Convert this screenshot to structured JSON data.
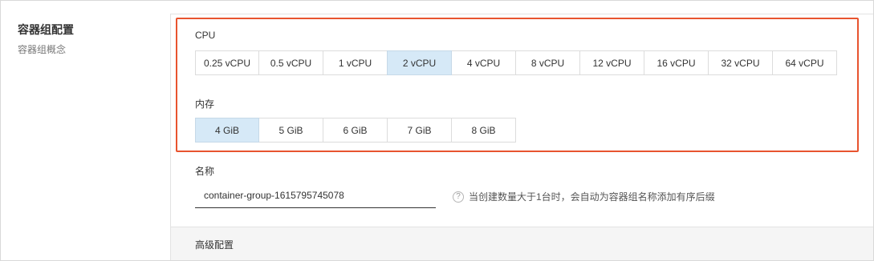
{
  "section": {
    "title": "容器组配置",
    "subtitle": "容器组概念"
  },
  "cpu": {
    "label": "CPU",
    "options": [
      "0.25 vCPU",
      "0.5 vCPU",
      "1 vCPU",
      "2 vCPU",
      "4 vCPU",
      "8 vCPU",
      "12 vCPU",
      "16 vCPU",
      "32 vCPU",
      "64 vCPU"
    ],
    "selected": "2 vCPU"
  },
  "memory": {
    "label": "内存",
    "options": [
      "4 GiB",
      "5 GiB",
      "6 GiB",
      "7 GiB",
      "8 GiB"
    ],
    "selected": "4 GiB"
  },
  "name": {
    "label": "名称",
    "value": "container-group-1615795745078",
    "hint_icon": "question-circle-icon",
    "hint": "当创建数量大于1台时，会自动为容器组名称添加有序后缀"
  },
  "advanced": {
    "label": "高级配置"
  },
  "colors": {
    "highlight_border": "#e8542f",
    "selected_bg": "#d6e9f7",
    "advanced_bg": "#f5f5f5"
  }
}
